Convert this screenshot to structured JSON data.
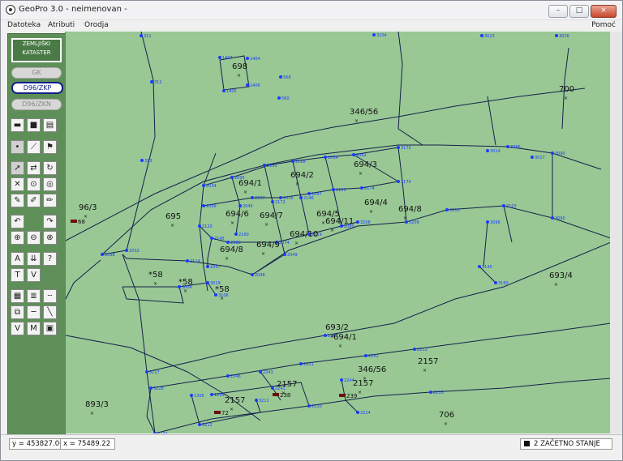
{
  "window": {
    "app": "GeoPro 3.0",
    "separator": " - ",
    "document": "neimenovan",
    "trail": " -",
    "controls": [
      "–",
      "□",
      "×"
    ]
  },
  "menu": {
    "items": [
      "Datoteka",
      "Atributi",
      "Orodja"
    ],
    "help": "Pomoć"
  },
  "toolbar": {
    "logo_lines": [
      "ZEMLJIŠKI",
      "KATASTER"
    ],
    "modes": [
      {
        "label": "GK",
        "active": false
      },
      {
        "label": "D96/ZKP",
        "active": true
      },
      {
        "label": "D96/ZKN",
        "active": false
      }
    ]
  },
  "status": {
    "y_label": "y =",
    "y_value": "453827.06",
    "x_label": "x =",
    "x_value": "75489.22",
    "state": "2  ZAČETNO STANJE"
  },
  "map": {
    "parcel_labels": [
      "698",
      "700",
      "346/56",
      "694/1",
      "694/2",
      "694/3",
      "694/4",
      "694/5",
      "694/6",
      "694/7",
      "694/11",
      "694/10",
      "694/9",
      "694/8",
      "695",
      "96/3",
      "*58",
      "*58",
      "*58",
      "693/4",
      "693/2",
      "2157",
      "2157",
      "2157",
      "2157",
      "893/3",
      "706",
      "346/56",
      "694/1",
      "694/8"
    ],
    "point_ids": [
      "311",
      "312",
      "313",
      "1407",
      "1404",
      "1406",
      "1405",
      "568",
      "560",
      "3104",
      "3023",
      "3016",
      "3017",
      "3014",
      "3175",
      "3170",
      "2174",
      "2121",
      "2047",
      "2056",
      "2097",
      "2095",
      "2034",
      "2099",
      "2120",
      "2145",
      "2160",
      "2172",
      "2146",
      "2168",
      "2152",
      "2034",
      "2082",
      "2119",
      "2089",
      "2074",
      "2088",
      "2047",
      "2045",
      "2048",
      "2049",
      "2032",
      "2098",
      "2114",
      "3004",
      "3019",
      "3106",
      "3145",
      "3160",
      "3096",
      "3090",
      "3103",
      "3086",
      "3090",
      "3208",
      "3209",
      "3210",
      "2221",
      "2243",
      "2241",
      "2242",
      "2244",
      "2224",
      "2252",
      "2253",
      "2210",
      "1295",
      "1305",
      "3212",
      "3211",
      "3217",
      "3228",
      "2204",
      "2246",
      "2247"
    ],
    "symbol_labels": [
      "238",
      "239",
      "72",
      "68"
    ]
  }
}
